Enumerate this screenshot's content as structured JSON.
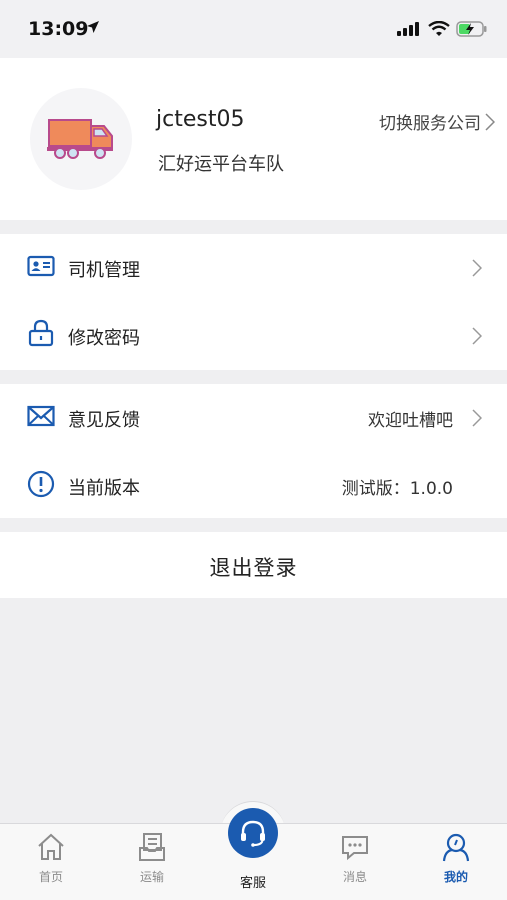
{
  "status_bar": {
    "time": "13:09"
  },
  "profile": {
    "username": "jctest05",
    "team": "汇好运平台车队",
    "switch_label": "切换服务公司"
  },
  "menu_group_1": [
    {
      "label": "司机管理",
      "icon": "id-card-icon"
    },
    {
      "label": "修改密码",
      "icon": "lock-icon"
    }
  ],
  "menu_group_2": [
    {
      "label": "意见反馈",
      "value": "欢迎吐槽吧",
      "icon": "envelope-icon"
    },
    {
      "label": "当前版本",
      "value": "测试版：1.0.0",
      "icon": "info-icon"
    }
  ],
  "logout_label": "退出登录",
  "tabbar": {
    "tabs": [
      {
        "label": "首页",
        "icon": "home-icon"
      },
      {
        "label": "运输",
        "icon": "document-icon"
      },
      {
        "label": "客服",
        "icon": "headset-icon"
      },
      {
        "label": "消息",
        "icon": "message-icon"
      },
      {
        "label": "我的",
        "icon": "user-icon"
      }
    ],
    "active_index": 4
  },
  "colors": {
    "accent": "#1b5bb0",
    "truck": "#ef8a5b",
    "truck_outline": "#b84a8c"
  }
}
